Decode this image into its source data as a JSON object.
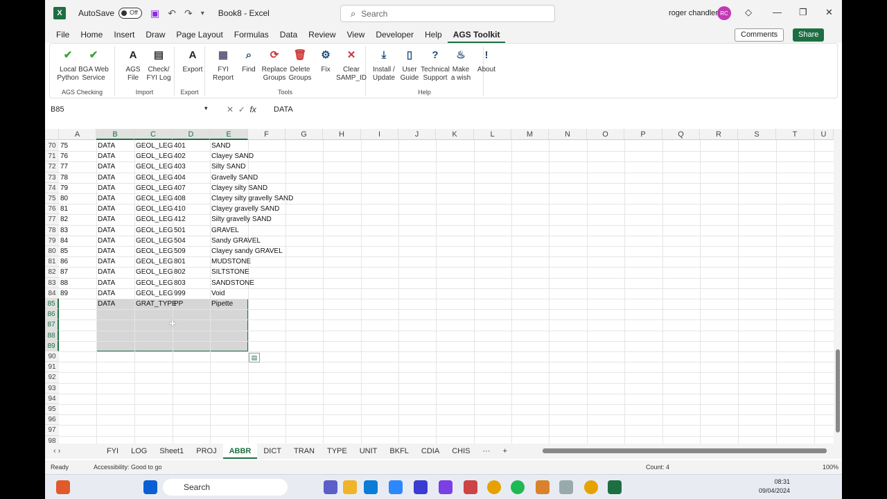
{
  "titlebar": {
    "autosave_label": "AutoSave",
    "autosave_state": "Off",
    "title": "Book8  -  Excel",
    "search_placeholder": "Search",
    "user": "roger chandler",
    "user_initials": "RC"
  },
  "menu": [
    "File",
    "Home",
    "Insert",
    "Draw",
    "Page Layout",
    "Formulas",
    "Data",
    "Review",
    "View",
    "Developer",
    "Help",
    "AGS Toolkit"
  ],
  "menu_active": "AGS Toolkit",
  "actions": {
    "comments": "Comments",
    "share": "Share"
  },
  "ribbon": {
    "groups": [
      {
        "label": "AGS Checking",
        "buttons": [
          {
            "l1": "Local",
            "l2": "Python",
            "icon": "checkmark-icon"
          },
          {
            "l1": "BGA Web",
            "l2": "Service",
            "icon": "bgs-check-icon"
          }
        ]
      },
      {
        "label": "Import",
        "buttons": [
          {
            "l1": "AGS",
            "l2": "File",
            "icon": "ags-file-icon"
          },
          {
            "l1": "Check/",
            "l2": "FYI Log",
            "icon": "document-icon"
          }
        ]
      },
      {
        "label": "Export",
        "buttons": [
          {
            "l1": "Export",
            "l2": "",
            "icon": "ags-export-icon"
          }
        ]
      },
      {
        "label": "Tools",
        "buttons": [
          {
            "l1": "FYI",
            "l2": "Report",
            "icon": "report-icon"
          },
          {
            "l1": "Find",
            "l2": "",
            "icon": "magnifier-icon"
          },
          {
            "l1": "Replace",
            "l2": "Groups",
            "icon": "replace-icon"
          },
          {
            "l1": "Delete",
            "l2": "Groups",
            "icon": "trash-icon"
          },
          {
            "l1": "Fix",
            "l2": "",
            "icon": "gear-icon"
          },
          {
            "l1": "Clear",
            "l2": "SAMP_ID",
            "icon": "clear-id-icon"
          }
        ]
      },
      {
        "label": "Help",
        "buttons": [
          {
            "l1": "Install /",
            "l2": "Update",
            "icon": "download-icon"
          },
          {
            "l1": "User",
            "l2": "Guide",
            "icon": "book-icon"
          },
          {
            "l1": "Technical",
            "l2": "Support",
            "icon": "question-icon"
          },
          {
            "l1": "Make",
            "l2": "a wish",
            "icon": "lamp-icon"
          },
          {
            "l1": "About",
            "l2": "",
            "icon": "info-icon"
          }
        ]
      }
    ]
  },
  "formula": {
    "namebox": "B85",
    "value": "DATA"
  },
  "columns": [
    "A",
    "B",
    "C",
    "D",
    "E",
    "F",
    "G",
    "H",
    "I",
    "J",
    "K",
    "L",
    "M",
    "N",
    "O",
    "P",
    "Q",
    "R",
    "S",
    "T",
    "U"
  ],
  "rows": [
    {
      "n": "70",
      "a": "75",
      "b": "DATA",
      "c": "GEOL_LEG",
      "d": "401",
      "e": "SAND"
    },
    {
      "n": "71",
      "a": "76",
      "b": "DATA",
      "c": "GEOL_LEG",
      "d": "402",
      "e": "Clayey SAND"
    },
    {
      "n": "72",
      "a": "77",
      "b": "DATA",
      "c": "GEOL_LEG",
      "d": "403",
      "e": "Silty SAND"
    },
    {
      "n": "73",
      "a": "78",
      "b": "DATA",
      "c": "GEOL_LEG",
      "d": "404",
      "e": "Gravelly SAND"
    },
    {
      "n": "74",
      "a": "79",
      "b": "DATA",
      "c": "GEOL_LEG",
      "d": "407",
      "e": "Clayey silty SAND"
    },
    {
      "n": "75",
      "a": "80",
      "b": "DATA",
      "c": "GEOL_LEG",
      "d": "408",
      "e": "Clayey silty gravelly SAND"
    },
    {
      "n": "76",
      "a": "81",
      "b": "DATA",
      "c": "GEOL_LEG",
      "d": "410",
      "e": "Clayey gravelly SAND"
    },
    {
      "n": "77",
      "a": "82",
      "b": "DATA",
      "c": "GEOL_LEG",
      "d": "412",
      "e": "Silty gravelly SAND"
    },
    {
      "n": "78",
      "a": "83",
      "b": "DATA",
      "c": "GEOL_LEG",
      "d": "501",
      "e": "GRAVEL"
    },
    {
      "n": "79",
      "a": "84",
      "b": "DATA",
      "c": "GEOL_LEG",
      "d": "504",
      "e": "Sandy GRAVEL"
    },
    {
      "n": "80",
      "a": "85",
      "b": "DATA",
      "c": "GEOL_LEG",
      "d": "509",
      "e": "Clayey sandy GRAVEL"
    },
    {
      "n": "81",
      "a": "86",
      "b": "DATA",
      "c": "GEOL_LEG",
      "d": "801",
      "e": "MUDSTONE"
    },
    {
      "n": "82",
      "a": "87",
      "b": "DATA",
      "c": "GEOL_LEG",
      "d": "802",
      "e": "SILTSTONE"
    },
    {
      "n": "83",
      "a": "88",
      "b": "DATA",
      "c": "GEOL_LEG",
      "d": "803",
      "e": "SANDSTONE"
    },
    {
      "n": "84",
      "a": "89",
      "b": "DATA",
      "c": "GEOL_LEG",
      "d": "999",
      "e": "Void"
    },
    {
      "n": "85",
      "a": "",
      "b": "DATA",
      "c": "GRAT_TYPE",
      "d": "PP",
      "e": "Pipette"
    },
    {
      "n": "86",
      "a": "",
      "b": "",
      "c": "",
      "d": "",
      "e": ""
    },
    {
      "n": "87",
      "a": "",
      "b": "",
      "c": "",
      "d": "",
      "e": ""
    },
    {
      "n": "88",
      "a": "",
      "b": "",
      "c": "",
      "d": "",
      "e": ""
    },
    {
      "n": "89",
      "a": "",
      "b": "",
      "c": "",
      "d": "",
      "e": ""
    },
    {
      "n": "90",
      "a": "",
      "b": "",
      "c": "",
      "d": "",
      "e": ""
    },
    {
      "n": "91",
      "a": "",
      "b": "",
      "c": "",
      "d": "",
      "e": ""
    },
    {
      "n": "92",
      "a": "",
      "b": "",
      "c": "",
      "d": "",
      "e": ""
    },
    {
      "n": "93",
      "a": "",
      "b": "",
      "c": "",
      "d": "",
      "e": ""
    },
    {
      "n": "94",
      "a": "",
      "b": "",
      "c": "",
      "d": "",
      "e": ""
    },
    {
      "n": "95",
      "a": "",
      "b": "",
      "c": "",
      "d": "",
      "e": ""
    },
    {
      "n": "96",
      "a": "",
      "b": "",
      "c": "",
      "d": "",
      "e": ""
    },
    {
      "n": "97",
      "a": "",
      "b": "",
      "c": "",
      "d": "",
      "e": ""
    },
    {
      "n": "98",
      "a": "",
      "b": "",
      "c": "",
      "d": "",
      "e": ""
    }
  ],
  "sheets": [
    "FYI",
    "LOG",
    "Sheet1",
    "PROJ",
    "ABBR",
    "DICT",
    "TRAN",
    "TYPE",
    "UNIT",
    "BKFL",
    "CDIA",
    "CHIS"
  ],
  "active_sheet": "ABBR",
  "status": {
    "ready": "Ready",
    "accessibility": "Accessibility: Good to go",
    "count": "Count: 4",
    "zoom": "100%"
  },
  "taskbar": {
    "search": "Search",
    "time": "08:31",
    "date": "09/04/2024",
    "teams_badge": "1",
    "mail_badge": "22"
  }
}
